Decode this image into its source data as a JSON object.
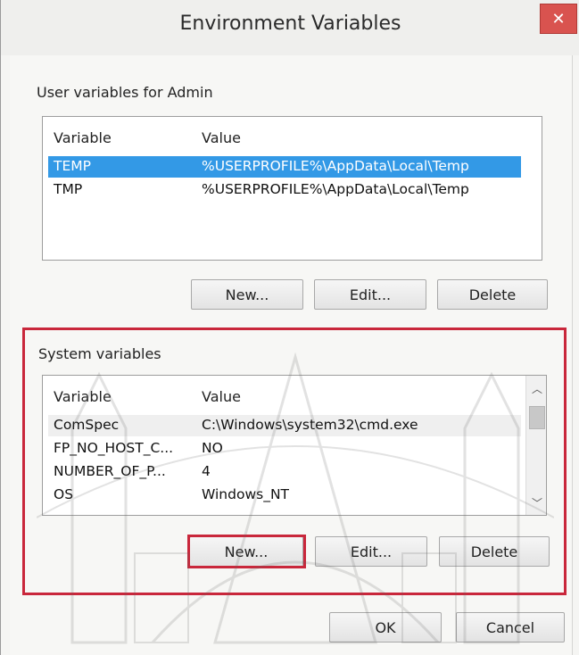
{
  "window": {
    "title": "Environment Variables",
    "close_label": "✕"
  },
  "user_vars": {
    "group_label": "User variables for Admin",
    "columns": [
      "Variable",
      "Value"
    ],
    "rows": [
      {
        "variable": "TEMP",
        "value": "%USERPROFILE%\\AppData\\Local\\Temp",
        "selected": true
      },
      {
        "variable": "TMP",
        "value": "%USERPROFILE%\\AppData\\Local\\Temp",
        "selected": false
      }
    ],
    "buttons": {
      "new": "New...",
      "edit": "Edit...",
      "delete": "Delete"
    }
  },
  "system_vars": {
    "group_label": "System variables",
    "columns": [
      "Variable",
      "Value"
    ],
    "rows": [
      {
        "variable": "ComSpec",
        "value": "C:\\Windows\\system32\\cmd.exe"
      },
      {
        "variable": "FP_NO_HOST_C...",
        "value": "NO"
      },
      {
        "variable": "NUMBER_OF_P...",
        "value": "4"
      },
      {
        "variable": "OS",
        "value": "Windows_NT"
      }
    ],
    "buttons": {
      "new": "New...",
      "edit": "Edit...",
      "delete": "Delete"
    }
  },
  "footer": {
    "ok": "OK",
    "cancel": "Cancel"
  },
  "colors": {
    "selection": "#3399e6",
    "highlight": "#c9273b",
    "close": "#d9534f"
  }
}
